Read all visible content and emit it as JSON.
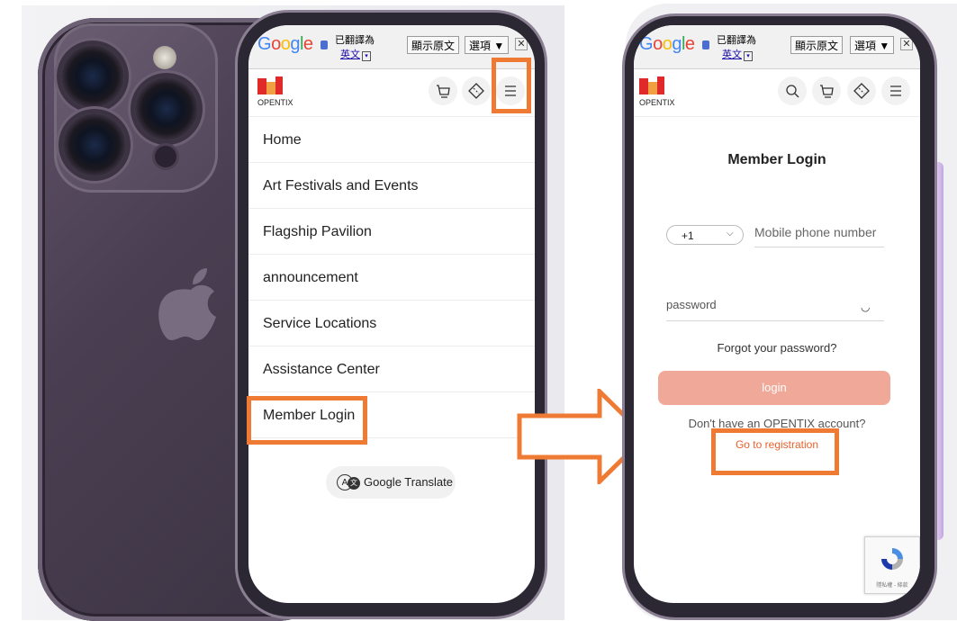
{
  "colors": {
    "accent_orange": "#ef7a33",
    "login_button": "#f0a898",
    "link_orange": "#e8622c",
    "opentix_red": "#e02a2a"
  },
  "translate_bar": {
    "translated_to": "已翻譯為",
    "language": "英文",
    "show_original": "顯示原文",
    "options": "選項 ▼",
    "close": "✕"
  },
  "brand": {
    "name": "OPENTIX"
  },
  "menu": {
    "items": [
      {
        "label": "Home"
      },
      {
        "label": "Art Festivals and Events"
      },
      {
        "label": "Flagship Pavilion"
      },
      {
        "label": "announcement"
      },
      {
        "label": "Service Locations"
      },
      {
        "label": "Assistance Center"
      },
      {
        "label": "Member Login"
      }
    ],
    "google_translate": "Google Translate"
  },
  "login": {
    "title": "Member Login",
    "country_code": "+1",
    "phone_placeholder": "Mobile phone number",
    "password_placeholder": "password",
    "forgot": "Forgot your password?",
    "login_button": "login",
    "no_account": "Don't have an OPENTIX account?",
    "register": "Go to registration"
  },
  "recaptcha": {
    "text": "隱私權 - 條款"
  },
  "icons": [
    "cart-icon",
    "ticket-icon",
    "menu-icon",
    "search-icon",
    "apple-icon",
    "arrow-right-icon",
    "eye-closed-icon",
    "recaptcha-icon"
  ]
}
